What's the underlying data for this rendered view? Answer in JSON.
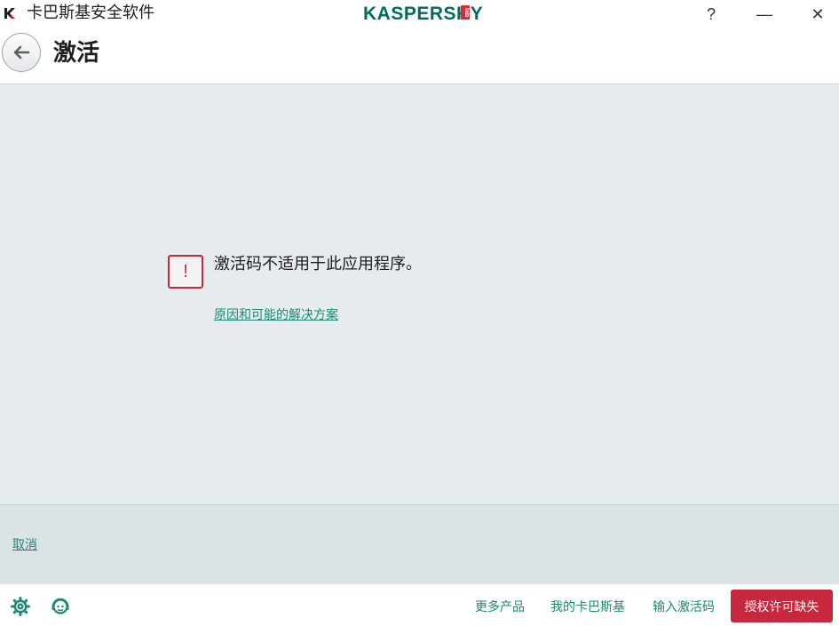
{
  "window": {
    "title": "卡巴斯基安全软件",
    "brand": "KASPERSKY",
    "brand_lab": "lab",
    "help_label": "?",
    "minimize_label": "—",
    "close_label": "✕"
  },
  "header": {
    "title": "激活"
  },
  "main": {
    "message": "激活码不适用于此应用程序。",
    "warning_glyph": "!",
    "reason_link": "原因和可能的解决方案"
  },
  "cancel_bar": {
    "cancel_label": "取消"
  },
  "footer": {
    "links": [
      "更多产品",
      "我的卡巴斯基",
      "输入激活码"
    ],
    "license_button": "授权许可缺失"
  },
  "colors": {
    "accent_green": "#1a8a74",
    "brand_green": "#006d5c",
    "alert_red": "#c8283d",
    "content_bg": "#e6ebee"
  }
}
